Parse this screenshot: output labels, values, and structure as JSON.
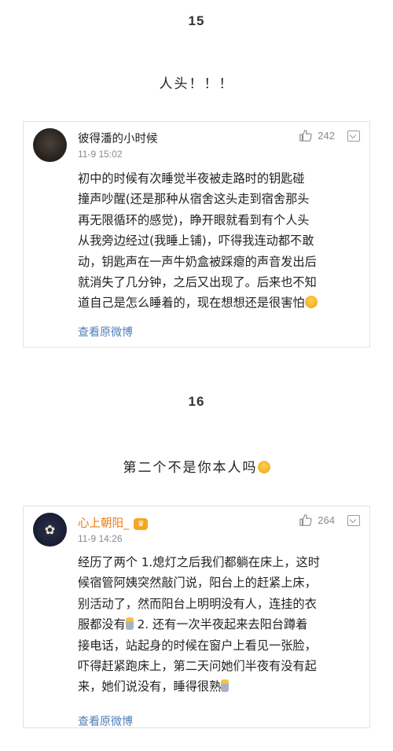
{
  "sections": [
    {
      "number": "15",
      "caption": "人头！！！",
      "comment": {
        "username": "彼得潘的小时候",
        "time": "11-9 15:02",
        "likes": "242",
        "lines": [
          "初中的时候有次睡觉半夜被走路时的钥匙碰",
          "撞声吵醒(还是那种从宿舍这头走到宿舍那头",
          "再无限循环的感觉)，睁开眼就看到有个人头",
          "从我旁边经过(我睡上铺)，吓得我连动都不敢",
          "动，钥匙声在一声牛奶盒被踩瘪的声音发出后",
          "就消失了几分钟，之后又出现了。后来也不知",
          "道自己是怎么睡着的，现在想想还是很害怕"
        ],
        "link": "查看原微博"
      }
    },
    {
      "number": "16",
      "caption": "第二个不是你本人吗",
      "comment": {
        "username": "心上朝阳_",
        "time": "11-9 14:26",
        "likes": "264",
        "lines": [
          "经历了两个 1.熄灯之后我们都躺在床上，这时",
          "候宿管阿姨突然敲门说，阳台上的赶紧上床，",
          "别活动了，然而阳台上明明没有人，连挂的衣",
          "服都没有",
          "接电话，站起身的时候在窗户上看见一张脸，",
          "吓得赶紧跑床上，第二天问她们半夜有没有起",
          "来，她们说没有，睡得很熟"
        ],
        "line4_suffix": " 2. 还有一次半夜起来去阳台蹲着",
        "link": "查看原微博"
      }
    }
  ],
  "icons": {
    "avatar2_glyph": "✿",
    "crown_glyph": "♛"
  }
}
